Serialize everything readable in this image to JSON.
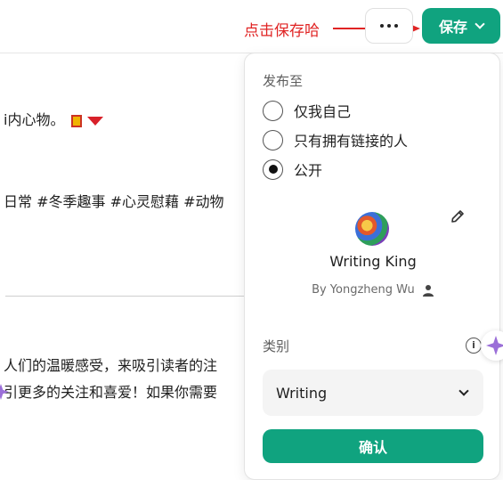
{
  "header": {
    "annotation": "点击保存哈",
    "more_icon": "more-horizontal-icon",
    "save_label": "保存"
  },
  "content": {
    "lines": [
      "i内心物。",
      "日常 #冬季趣事 #心灵慰藉 #动物",
      "人们的温暖感受，来吸引读者的注",
      "引更多的关注和喜爱！如果你需要"
    ]
  },
  "panel": {
    "publish_to_label": "发布至",
    "options": [
      {
        "label": "仅我自己",
        "selected": false
      },
      {
        "label": "只有拥有链接的人",
        "selected": false
      },
      {
        "label": "公开",
        "selected": true
      }
    ],
    "gpt_name": "Writing King",
    "byline": "By Yongzheng Wu",
    "category_label": "类别",
    "category_value": "Writing",
    "confirm_label": "确认"
  },
  "colors": {
    "accent": "#10a37f",
    "annotation": "#e02424",
    "sparkle": "#9b6fd8"
  }
}
